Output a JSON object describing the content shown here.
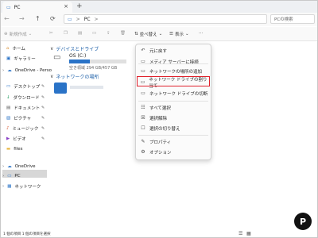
{
  "window": {
    "tab_title": "PC",
    "tab_close": "×",
    "tab_add": "+"
  },
  "nav": {
    "back": "←",
    "forward": "→",
    "up": "↑",
    "refresh": "⟳",
    "breadcrumb_root": "PC",
    "breadcrumb_sep": ">",
    "search_placeholder": "PCの検索"
  },
  "toolbar": {
    "new_label": "新規作成",
    "sort_label": "並べ替え",
    "view_label": "表示",
    "more_label": "···"
  },
  "sidebar": {
    "items": [
      {
        "label": "ホーム",
        "icon": "home-icon",
        "glyph": "⌂",
        "color": "#d98b2b"
      },
      {
        "label": "ギャラリー",
        "icon": "gallery-icon",
        "glyph": "▣",
        "color": "#2a73c7"
      },
      {
        "label": "OneDrive - Perso",
        "icon": "cloud-icon",
        "glyph": "☁",
        "color": "#2a73c7"
      },
      {
        "label": "デスクトップ",
        "icon": "desktop-icon",
        "glyph": "▭",
        "color": "#2a73c7"
      },
      {
        "label": "ダウンロード",
        "icon": "download-icon",
        "glyph": "↓",
        "color": "#1a9a5a"
      },
      {
        "label": "ドキュメント",
        "icon": "document-icon",
        "glyph": "▤",
        "color": "#555555"
      },
      {
        "label": "ピクチャ",
        "icon": "pictures-icon",
        "glyph": "▧",
        "color": "#2a73c7"
      },
      {
        "label": "ミュージック",
        "icon": "music-icon",
        "glyph": "♪",
        "color": "#d9542b"
      },
      {
        "label": "ビデオ",
        "icon": "video-icon",
        "glyph": "▶",
        "color": "#8a3fc7"
      },
      {
        "label": "files",
        "icon": "folder-icon",
        "glyph": "▬",
        "color": "#e8b43a"
      },
      {
        "label": "OneDrive",
        "icon": "cloud-icon",
        "glyph": "☁",
        "color": "#2a73c7"
      },
      {
        "label": "PC",
        "icon": "pc-icon",
        "glyph": "▭",
        "color": "#2a73c7"
      },
      {
        "label": "ネットワーク",
        "icon": "network-icon",
        "glyph": "▦",
        "color": "#2a73c7"
      }
    ],
    "pin_glyph": "✎"
  },
  "content": {
    "devices_header": "デバイスとドライブ",
    "drive_name": "OS (C:)",
    "drive_info": "空き領域 294 GB/457 GB",
    "drive_used_fraction": 0.36,
    "network_header": "ネットワークの場所",
    "network_item_label": "",
    "chevron": "∨"
  },
  "menu": {
    "items": [
      {
        "label": "元に戻す",
        "icon": "undo-icon",
        "glyph": "↶"
      },
      {
        "label": "メディア サーバーに接続",
        "icon": "media-server-icon",
        "glyph": "▭"
      },
      {
        "label": "ネットワークの場所の追加",
        "icon": "add-network-location-icon",
        "glyph": "▭"
      },
      {
        "label": "ネットワーク ドライブの割り当て",
        "icon": "map-network-drive-icon",
        "glyph": "▭"
      },
      {
        "label": "ネットワーク ドライブの切断",
        "icon": "disconnect-network-drive-icon",
        "glyph": "▭"
      },
      {
        "label": "すべて選択",
        "icon": "select-all-icon",
        "glyph": "☷"
      },
      {
        "label": "選択解除",
        "icon": "select-none-icon",
        "glyph": "☒"
      },
      {
        "label": "選択の切り替え",
        "icon": "invert-selection-icon",
        "glyph": "☐"
      },
      {
        "label": "プロパティ",
        "icon": "properties-icon",
        "glyph": "✎"
      },
      {
        "label": "オプション",
        "icon": "options-icon",
        "glyph": "⚙"
      }
    ],
    "highlight_color": "#e0212b"
  },
  "status": {
    "text": "1 個の項目   1 個の項目を選択"
  },
  "badge": {
    "glyph": "P"
  }
}
